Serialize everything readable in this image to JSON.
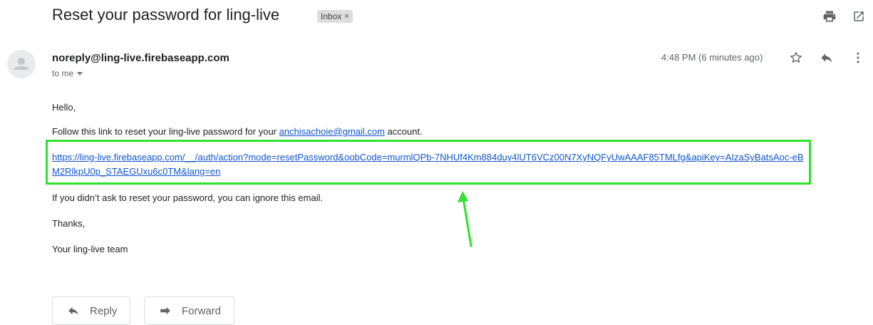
{
  "email": {
    "subject": "Reset your password for ling-live",
    "label_badge": "Inbox",
    "label_remove": "×",
    "sender": "noreply@ling-live.firebaseapp.com",
    "recipient": "to me",
    "timestamp": "4:48 PM (6 minutes ago)"
  },
  "body": {
    "greeting": "Hello,",
    "instruction_prefix": "Follow this link to reset your ling-live password for your ",
    "account_email": "anchisachoie@gmail.com",
    "instruction_suffix": " account.",
    "reset_link": "https://ling-live.firebaseapp.com/__/auth/action?mode=resetPassword&oobCode=murmlQPb-7NHUf4Km884duy4lUT6VCz00N7XyNQFyUwAAAF85TMLfg&apiKey=AIzaSyBatsAoc-eBM2RlkpU0p_STAEGUxu6c0TM&lang=en",
    "ignore_note": "If you didn’t ask to reset your password, you can ignore this email.",
    "thanks": "Thanks,",
    "signature": "Your ling-live team"
  },
  "actions": {
    "reply_label": "Reply",
    "forward_label": "Forward"
  },
  "annotation": {
    "highlight_color": "#2ee42c"
  },
  "icons": {
    "print": "print-icon",
    "open_new_window": "open-in-new-window-icon",
    "star": "star-icon",
    "reply": "reply-icon",
    "more": "more-vertical-icon",
    "avatar": "avatar-person-icon",
    "forward": "forward-icon"
  }
}
